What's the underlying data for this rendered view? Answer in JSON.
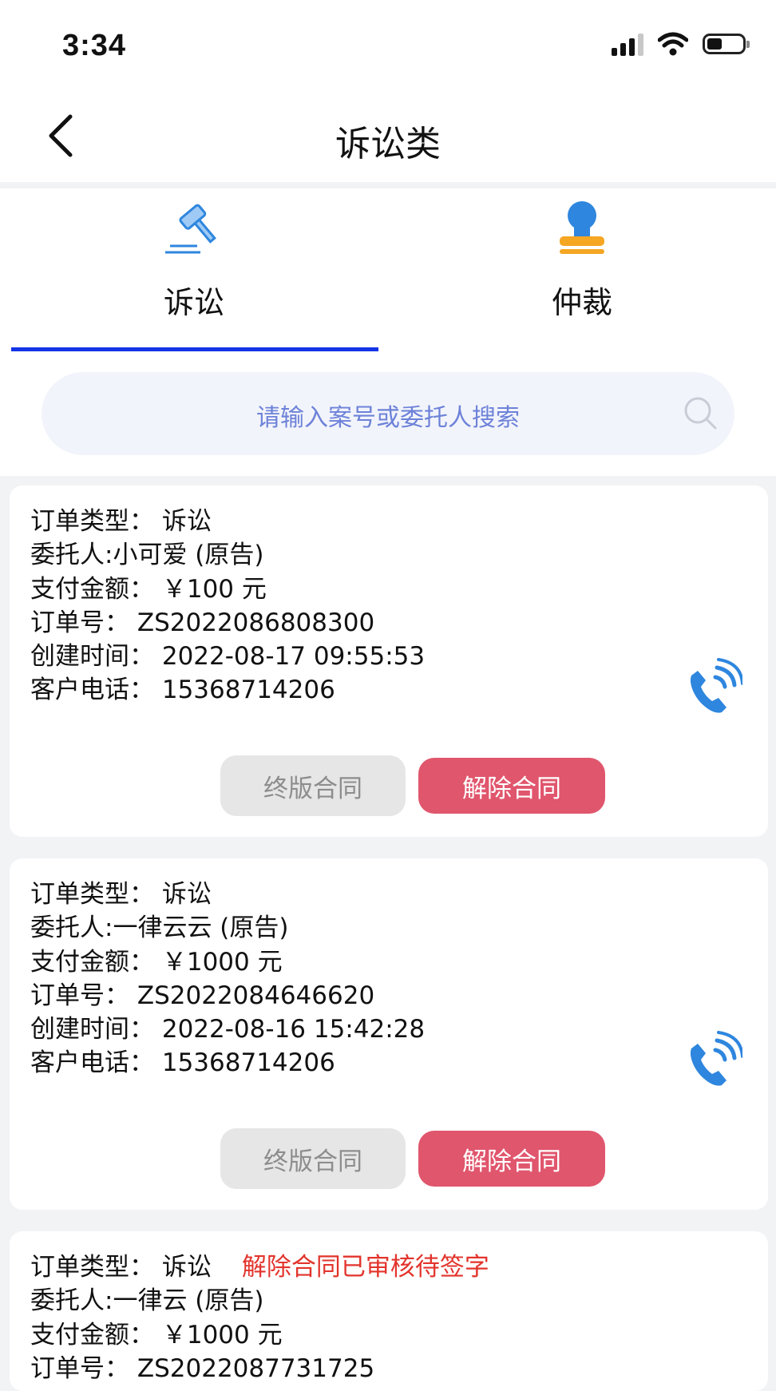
{
  "status_bar": {
    "time": "3:34"
  },
  "nav": {
    "title": "诉讼类"
  },
  "tabs": [
    {
      "label": "诉讼",
      "icon": "gavel-icon",
      "active": true
    },
    {
      "label": "仲裁",
      "icon": "stamp-icon",
      "active": false
    }
  ],
  "search": {
    "placeholder": "请输入案号或委托人搜索"
  },
  "colors": {
    "accent": "#1434e6",
    "danger_button": "#e0566d",
    "alert_text": "#e2342c",
    "icon_blue": "#2e86de"
  },
  "orders": [
    {
      "type_line": "订单类型：  诉讼",
      "alert": "",
      "client_line": "委托人:小可爱 (原告)",
      "amount_line": "支付金额：  ￥100 元",
      "order_no_line": "订单号：  ZS2022086808300",
      "created_line": "创建时间：  2022-08-17 09:55:53",
      "phone_line": "客户电话：  15368714206",
      "btn_final": "终版合同",
      "btn_cancel": "解除合同"
    },
    {
      "type_line": "订单类型：  诉讼",
      "alert": "",
      "client_line": "委托人:一律云云 (原告)",
      "amount_line": "支付金额：  ￥1000 元",
      "order_no_line": "订单号：  ZS2022084646620",
      "created_line": "创建时间：  2022-08-16 15:42:28",
      "phone_line": "客户电话：  15368714206",
      "btn_final": "终版合同",
      "btn_cancel": "解除合同"
    },
    {
      "type_line": "订单类型：  诉讼",
      "alert": "解除合同已审核待签字",
      "client_line": "委托人:一律云 (原告)",
      "amount_line": "支付金额：  ￥1000 元",
      "order_no_line": "订单号：  ZS2022087731725"
    }
  ]
}
